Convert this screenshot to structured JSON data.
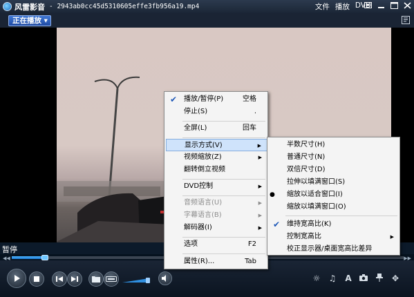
{
  "window": {
    "app_name": "风雷影音",
    "file_name": "- 2943ab0cc45d5310605effe3fb956a19.mp4",
    "menus": [
      "文件",
      "播放",
      "DVD"
    ]
  },
  "toolbar": {
    "now_playing_label": "正在播放 ▾"
  },
  "status": {
    "text": "暂停"
  },
  "context_menu": {
    "items": [
      {
        "label": "播放/暂停(P)",
        "shortcut": "空格",
        "checked": true
      },
      {
        "label": "停止(S)",
        "shortcut": "."
      },
      {
        "label": "全屏(L)",
        "shortcut": "回车"
      },
      {
        "label": "显示方式(V)",
        "submenu": true
      },
      {
        "label": "视频缩放(Z)",
        "submenu": true
      },
      {
        "label": "翻转倒立视频"
      },
      {
        "label": "DVD控制",
        "submenu": true
      },
      {
        "label": "音频语言(U)",
        "submenu": true,
        "disabled": true
      },
      {
        "label": "字幕语言(B)",
        "submenu": true,
        "disabled": true
      },
      {
        "label": "解码器(I)",
        "submenu": true
      },
      {
        "label": "选项",
        "shortcut": "F2"
      },
      {
        "label": "属性(R)...",
        "shortcut": "Tab"
      }
    ]
  },
  "display_submenu": {
    "items": [
      {
        "label": "半数尺寸(H)"
      },
      {
        "label": "普通尺寸(N)"
      },
      {
        "label": "双倍尺寸(D)"
      },
      {
        "label": "拉伸以填满窗口(S)"
      },
      {
        "label": "缩放以适合窗口(I)",
        "selected": true
      },
      {
        "label": "缩放以填满窗口(O)"
      },
      {
        "label": "维持宽高比(K)",
        "checked": true
      },
      {
        "label": "控制宽高比",
        "submenu": true
      },
      {
        "label": "校正显示器/桌面宽高比差异"
      }
    ]
  },
  "colors": {
    "accent": "#2a5fc0",
    "menu_bg": "#f4f4f4",
    "highlight": "#cfe3fb"
  },
  "playback": {
    "position_fraction": 0.09
  }
}
